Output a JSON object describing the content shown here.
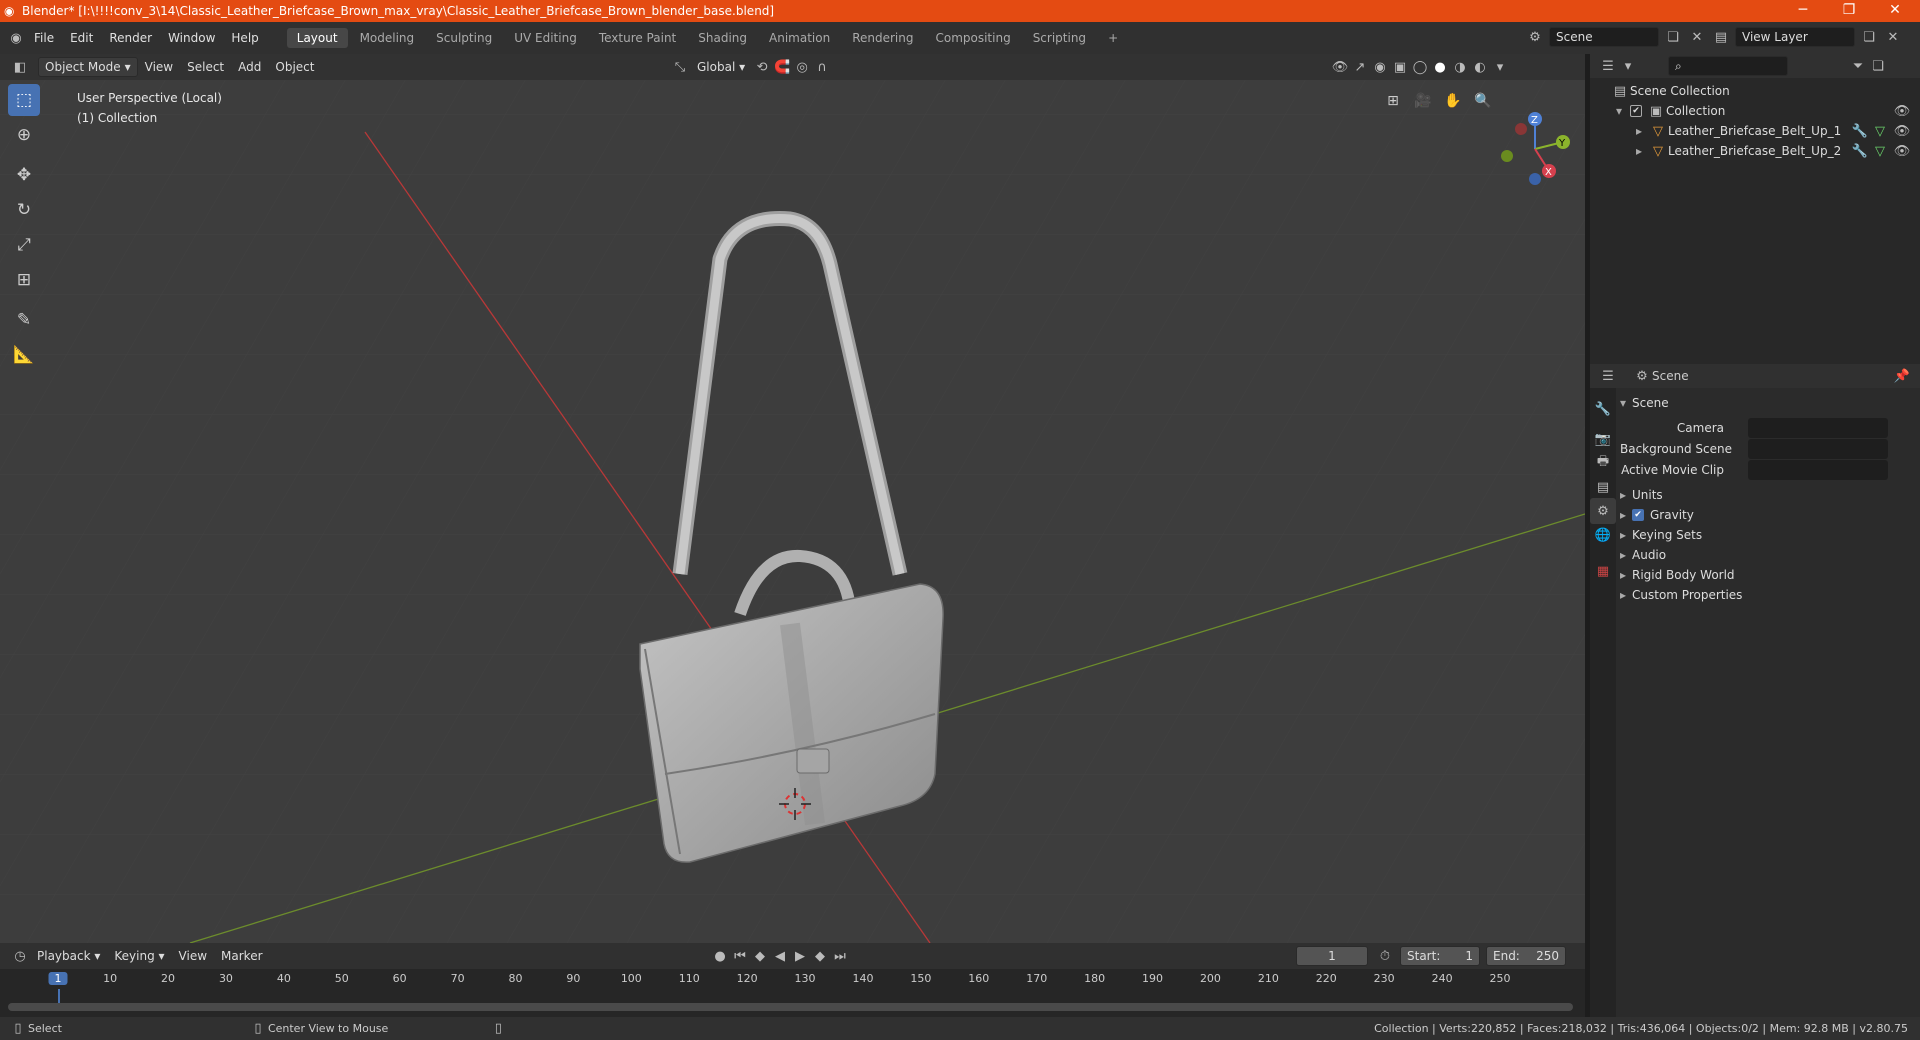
{
  "titlebar": {
    "title": "Blender* [I:\\!!!!conv_3\\14\\Classic_Leather_Briefcase_Brown_max_vray\\Classic_Leather_Briefcase_Brown_blender_base.blend]",
    "minimize": "─",
    "maximize": "❐",
    "close": "✕"
  },
  "menus": [
    "File",
    "Edit",
    "Render",
    "Window",
    "Help"
  ],
  "workspaces": [
    "Layout",
    "Modeling",
    "Sculpting",
    "UV Editing",
    "Texture Paint",
    "Shading",
    "Animation",
    "Rendering",
    "Compositing",
    "Scripting"
  ],
  "add_workspace": "+",
  "scene": {
    "label": "Scene"
  },
  "view_layer": {
    "label": "View Layer"
  },
  "viewport_header": {
    "mode": "Object Mode",
    "menus": [
      "View",
      "Select",
      "Add",
      "Object"
    ],
    "transform": "Global"
  },
  "viewport": {
    "perspective": "User Perspective (Local)",
    "collection": "(1) Collection"
  },
  "gizmo": {
    "x": "X",
    "y": "Y",
    "z": "Z"
  },
  "outliner": {
    "root": "Scene Collection",
    "collection": "Collection",
    "items": [
      "Leather_Briefcase_Belt_Up_1",
      "Leather_Briefcase_Belt_Up_2"
    ]
  },
  "properties": {
    "context": "Scene",
    "panel": "Scene",
    "camera_label": "Camera",
    "background_label": "Background Scene",
    "movieclip_label": "Active Movie Clip",
    "sections": [
      "Units",
      "Gravity",
      "Keying Sets",
      "Audio",
      "Rigid Body World",
      "Custom Properties"
    ]
  },
  "timeline": {
    "menus": [
      "Playback",
      "Keying",
      "View",
      "Marker"
    ],
    "current_frame": "1",
    "start_label": "Start:",
    "start": "1",
    "end_label": "End:",
    "end": "250",
    "ticks": [
      "1",
      "10",
      "20",
      "30",
      "40",
      "50",
      "60",
      "70",
      "80",
      "90",
      "100",
      "110",
      "120",
      "130",
      "140",
      "150",
      "160",
      "170",
      "180",
      "190",
      "200",
      "210",
      "220",
      "230",
      "240",
      "250"
    ]
  },
  "statusbar": {
    "select": "Select",
    "center": "Center View to Mouse",
    "stats": "Collection | Verts:220,852 | Faces:218,032 | Tris:436,064 | Objects:0/2 | Mem: 92.8 MB | v2.80.75"
  },
  "colors": {
    "accent": "#4772b3",
    "titlebar": "#e44b12",
    "x_axis": "#b83838",
    "y_axis": "#6c8c2c"
  }
}
